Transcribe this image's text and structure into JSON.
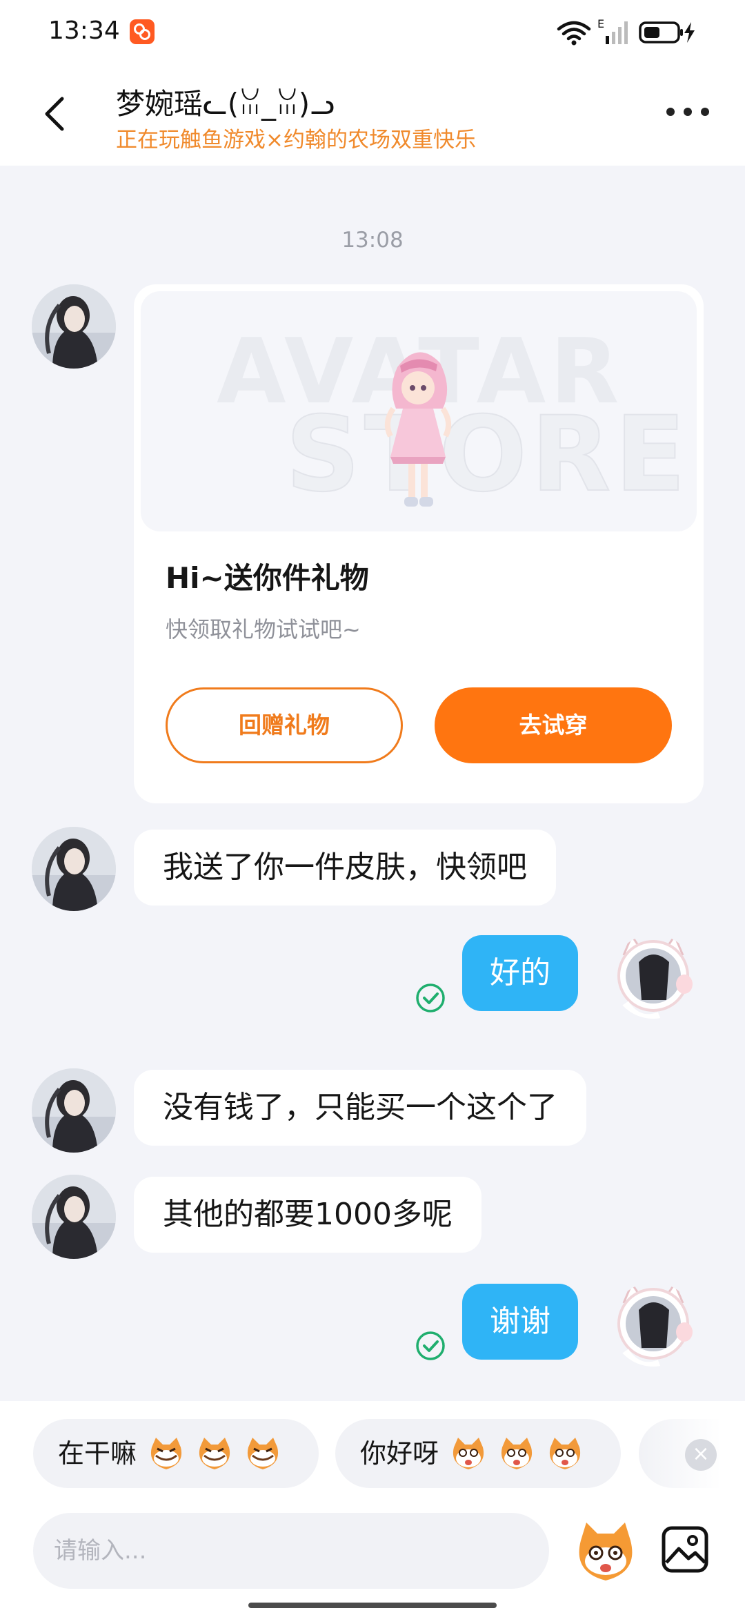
{
  "status_bar": {
    "time": "13:34",
    "app_icon": "app-notification-icon",
    "network_label": "E",
    "battery_icon": "battery-charging-icon"
  },
  "header": {
    "back_icon": "chevron-left-icon",
    "title": "梦婉瑶ᓚ(ꈍ_ꈍ)ᓗ",
    "subtitle": "正在玩触鱼游戏×约翰的农场双重快乐",
    "more_icon": "more-dots-icon"
  },
  "chat": {
    "timestamp": "13:08",
    "gift_card": {
      "banner_text_1": "AVATAR",
      "banner_text_2": "STORE",
      "title": "Hi~送你件礼物",
      "description": "快领取礼物试试吧~",
      "return_gift_label": "回赠礼物",
      "try_on_label": "去试穿",
      "accent_color": "#ff7510"
    },
    "messages": [
      {
        "side": "in",
        "text": "我送了你一件皮肤，快领吧"
      },
      {
        "side": "out",
        "text": "好的",
        "status": "read"
      },
      {
        "side": "in",
        "text": "没有钱了，只能买一个这个了"
      },
      {
        "side": "in",
        "text": "其他的都要1000多呢"
      },
      {
        "side": "out",
        "text": "谢谢",
        "status": "read"
      }
    ],
    "outgoing_bubble_color": "#2fb4f6",
    "read_check_color": "#1fae6e"
  },
  "quick_replies": [
    {
      "text": "在干嘛",
      "emoji": "grinning-cat-emoji"
    },
    {
      "text": "你好呀",
      "emoji": "smiling-cat-emoji"
    }
  ],
  "composer": {
    "placeholder": "请输入...",
    "sticker_icon": "cat-sticker-icon",
    "image_icon": "image-icon",
    "close_icon": "close-icon"
  }
}
